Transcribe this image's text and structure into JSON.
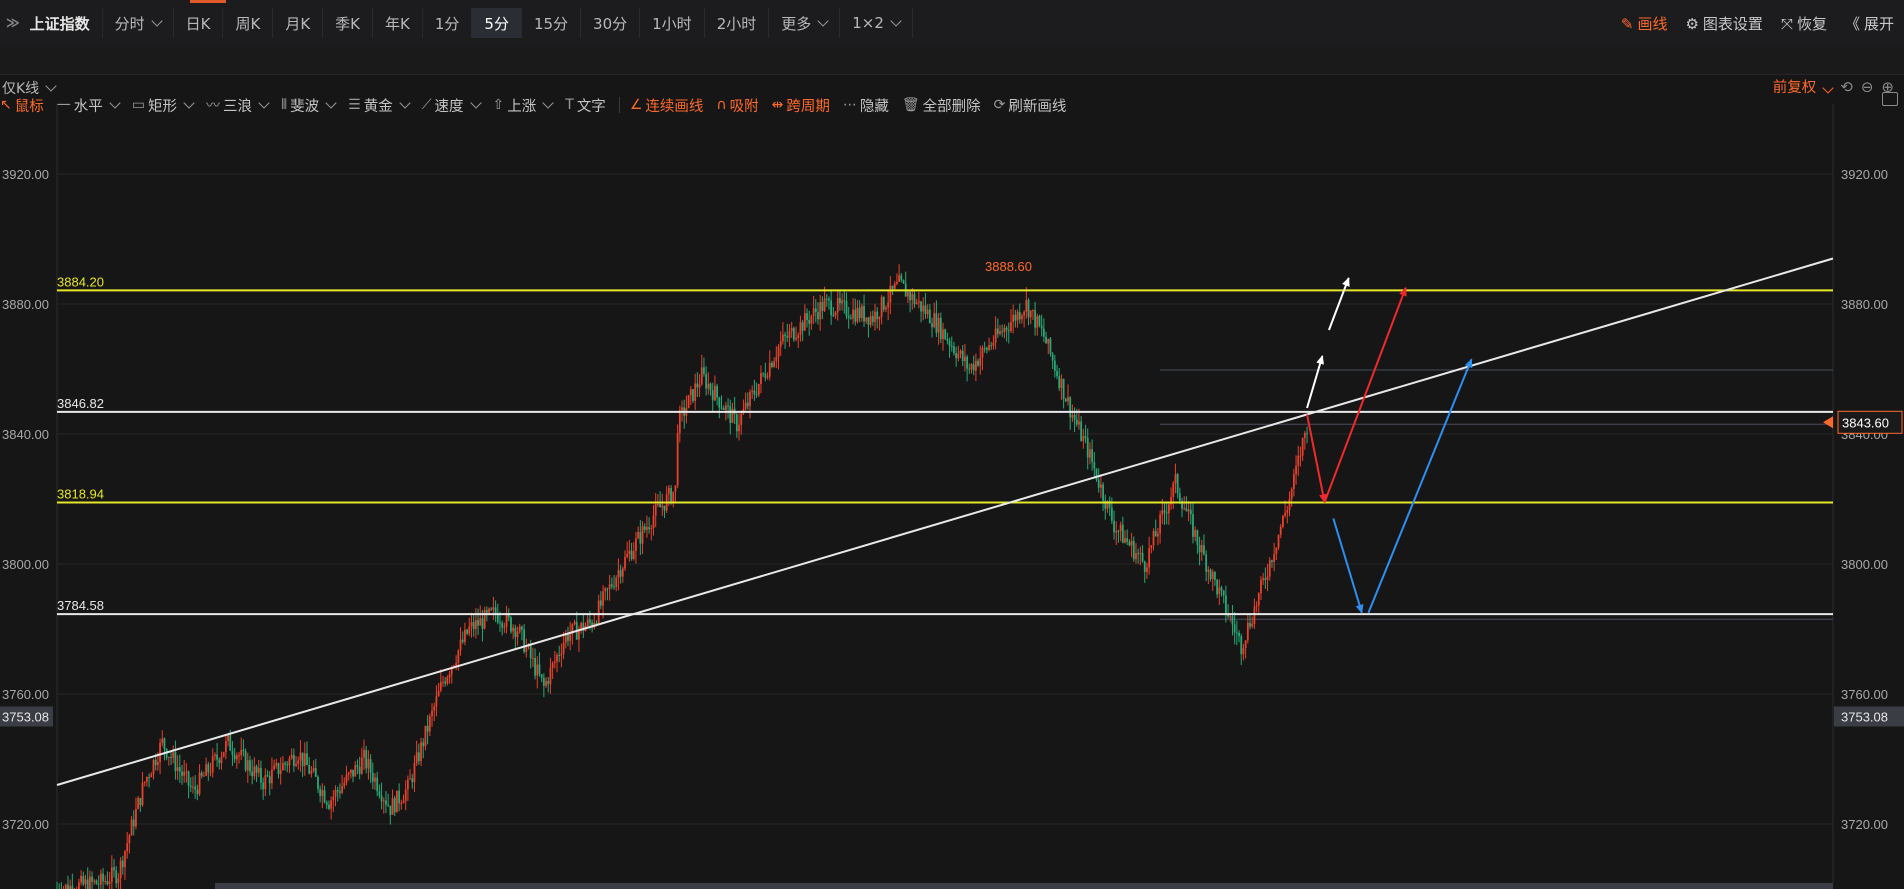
{
  "topbar": {
    "tabs": [
      {
        "label": "上证指数",
        "kind": "index"
      },
      {
        "label": "分时",
        "dropdown": true
      },
      {
        "label": "日K"
      },
      {
        "label": "周K"
      },
      {
        "label": "月K"
      },
      {
        "label": "季K"
      },
      {
        "label": "年K"
      },
      {
        "label": "1分"
      },
      {
        "label": "5分",
        "active": true
      },
      {
        "label": "15分"
      },
      {
        "label": "30分"
      },
      {
        "label": "1小时"
      },
      {
        "label": "2小时"
      },
      {
        "label": "更多",
        "dropdown": true
      },
      {
        "label": "1×2",
        "dropdown": true
      }
    ],
    "right_tools": [
      {
        "label": "画线",
        "icon": "pencil-icon",
        "highlight": true
      },
      {
        "label": "图表设置",
        "icon": "gear-icon"
      },
      {
        "label": "恢复",
        "icon": "restore-icon"
      },
      {
        "label": "展开",
        "icon": "double-chevron-left-icon"
      }
    ]
  },
  "drawbar": {
    "tools": [
      {
        "label": "鼠标",
        "icon": "cursor-icon",
        "highlight": true
      },
      {
        "label": "水平",
        "icon": "horizontal-line-icon",
        "dropdown": true
      },
      {
        "label": "矩形",
        "icon": "rectangle-icon",
        "dropdown": true
      },
      {
        "label": "三浪",
        "icon": "wave-icon",
        "dropdown": true
      },
      {
        "label": "斐波",
        "icon": "fibonacci-icon",
        "dropdown": true
      },
      {
        "label": "黄金",
        "icon": "golden-ratio-icon",
        "dropdown": true
      },
      {
        "label": "速度",
        "icon": "speed-line-icon",
        "dropdown": true
      },
      {
        "label": "上涨",
        "icon": "up-arrow-icon",
        "dropdown": true
      },
      {
        "label": "文字",
        "icon": "text-icon"
      },
      {
        "label": "连续画线",
        "icon": "continuous-draw-icon",
        "highlight": true,
        "separator_before": true
      },
      {
        "label": "吸附",
        "icon": "magnet-icon",
        "highlight": true
      },
      {
        "label": "跨周期",
        "icon": "cross-period-icon",
        "highlight": true
      },
      {
        "label": "隐藏",
        "icon": "hide-icon"
      },
      {
        "label": "全部删除",
        "icon": "trash-icon"
      },
      {
        "label": "刷新画线",
        "icon": "refresh-icon"
      }
    ]
  },
  "subbar": {
    "view_label": "仅K线",
    "adjust_label": "前复权"
  },
  "colors": {
    "up": "#e8412c",
    "down": "#2aa876",
    "yellow_line": "#e6e62a",
    "white_line": "#e8e8e8",
    "accent": "#ff6a2b",
    "blue_arrow": "#2f8ff0"
  },
  "chart_data": {
    "type": "candlestick",
    "timeframe": "5分",
    "y_ticks": [
      3720,
      3760,
      3800,
      3840,
      3880,
      3920
    ],
    "y_tick_labels": [
      "3720.00",
      "3760.00",
      "3800.00",
      "3840.00",
      "3880.00",
      "3920.00"
    ],
    "ylim": [
      3700,
      3943
    ],
    "bar_count": 300,
    "high_label": "3888.60",
    "current_price": "3843.60",
    "crosshair_price": "3753.08",
    "horizontal_lines": [
      {
        "value": 3884.2,
        "label": "3884.20",
        "color": "yellow"
      },
      {
        "value": 3846.82,
        "label": "3846.82",
        "color": "white"
      },
      {
        "value": 3818.94,
        "label": "3818.94",
        "color": "yellow"
      },
      {
        "value": 3784.58,
        "label": "3784.58",
        "color": "white"
      }
    ],
    "faint_levels": [
      3859.7,
      3843.0,
      3783.0
    ],
    "trendline": {
      "from": {
        "bar": 0,
        "value": 3732
      },
      "to": {
        "bar": 300,
        "value": 3894
      }
    },
    "path_anchors": [
      [
        0,
        3700
      ],
      [
        20,
        3702
      ],
      [
        28,
        3705
      ],
      [
        40,
        3733
      ],
      [
        48,
        3745
      ],
      [
        62,
        3730
      ],
      [
        78,
        3745
      ],
      [
        94,
        3733
      ],
      [
        110,
        3742
      ],
      [
        124,
        3727
      ],
      [
        140,
        3740
      ],
      [
        152,
        3725
      ],
      [
        160,
        3731
      ],
      [
        176,
        3764
      ],
      [
        188,
        3780
      ],
      [
        200,
        3785
      ],
      [
        210,
        3780
      ],
      [
        222,
        3762
      ],
      [
        232,
        3778
      ],
      [
        244,
        3782
      ],
      [
        256,
        3798
      ],
      [
        272,
        3815
      ],
      [
        282,
        3823
      ],
      [
        283,
        3843
      ],
      [
        294,
        3858
      ],
      [
        310,
        3843
      ],
      [
        330,
        3868
      ],
      [
        350,
        3880
      ],
      [
        372,
        3876
      ],
      [
        384,
        3886
      ],
      [
        400,
        3875
      ],
      [
        416,
        3860
      ],
      [
        426,
        3868
      ],
      [
        442,
        3880
      ],
      [
        450,
        3870
      ],
      [
        463,
        3846
      ],
      [
        470,
        3835
      ],
      [
        482,
        3812
      ],
      [
        496,
        3800
      ],
      [
        510,
        3825
      ],
      [
        520,
        3807
      ],
      [
        540,
        3775
      ],
      [
        548,
        3790
      ],
      [
        562,
        3820
      ],
      [
        570,
        3843
      ]
    ],
    "annotation_arrows": [
      {
        "color": "white",
        "from": {
          "bar": 570,
          "value": 3848
        },
        "to": {
          "bar": 577,
          "value": 3864
        }
      },
      {
        "color": "white",
        "from": {
          "bar": 580,
          "value": 3872
        },
        "to": {
          "bar": 589,
          "value": 3888
        }
      },
      {
        "color": "red",
        "from": {
          "bar": 570,
          "value": 3846
        },
        "to": {
          "bar": 578,
          "value": 3819
        }
      },
      {
        "color": "red",
        "from": {
          "bar": 578,
          "value": 3819
        },
        "to": {
          "bar": 615,
          "value": 3885
        }
      },
      {
        "color": "blue",
        "from": {
          "bar": 582,
          "value": 3814
        },
        "to": {
          "bar": 595,
          "value": 3785
        }
      },
      {
        "color": "blue",
        "from": {
          "bar": 598,
          "value": 3785
        },
        "to": {
          "bar": 645,
          "value": 3863
        }
      }
    ]
  }
}
